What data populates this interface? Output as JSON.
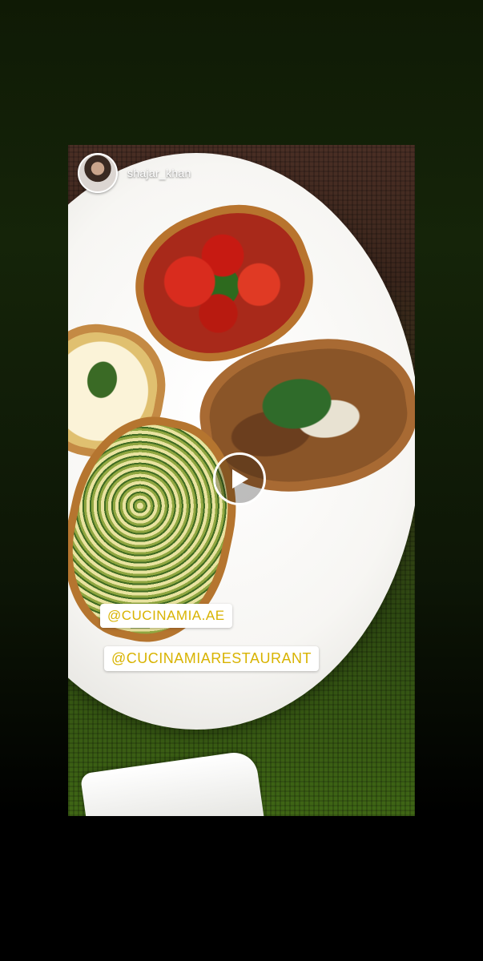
{
  "story": {
    "username": "shajar_khan",
    "mentions": [
      "@CUCINAMIA.AE",
      "@CUCINAMIARESTAURANT"
    ],
    "play_icon": "play-icon",
    "avatar_icon": "avatar"
  },
  "colors": {
    "tag_text": "#d8b300",
    "tag_background": "#ffffff",
    "background_top": "#152409",
    "background_bottom": "#000000"
  }
}
